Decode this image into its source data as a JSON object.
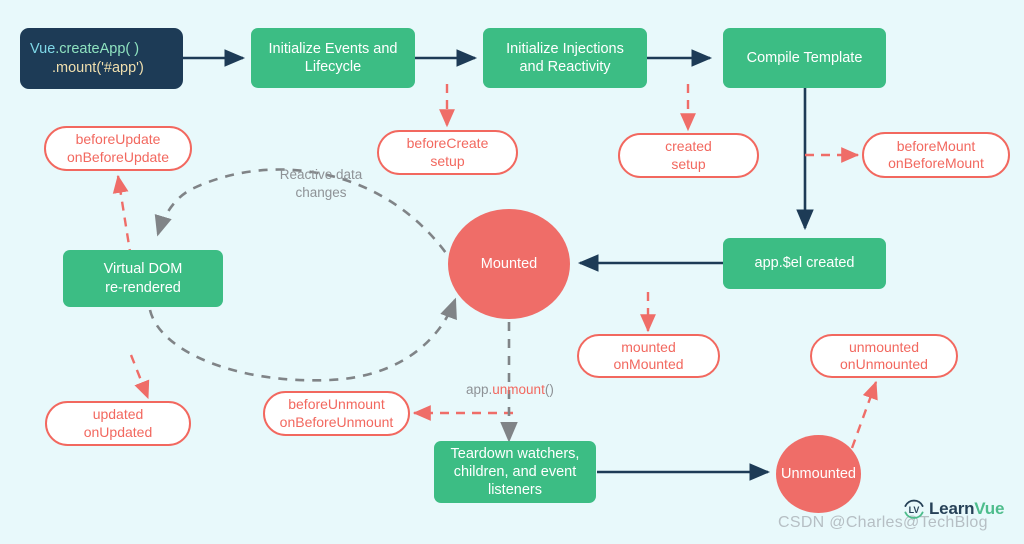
{
  "diagram": {
    "title": "Vue 3 Lifecycle Diagram",
    "background_color": "#e8f9fb",
    "colors": {
      "green": "#3cbd84",
      "dark_navy": "#1d3b56",
      "red": "#ef6d68",
      "pill_border": "#f2685f",
      "gray_dashed": "#808487",
      "label_gray": "#8e9296"
    }
  },
  "entry": {
    "line1_prefix": "Vue",
    "line1_rest": ".createApp( )",
    "line2": ".mount('#app')"
  },
  "stages": [
    {
      "label": "Initialize Events and Lifecycle"
    },
    {
      "label": "Initialize Injections and Reactivity"
    },
    {
      "label": "Compile Template"
    },
    {
      "label": "app.$el created"
    },
    {
      "label": "Virtual DOM re-rendered"
    },
    {
      "label": "Teardown watchers, children, and event listeners"
    }
  ],
  "stage_lines": {
    "init_events_1": "Initialize Events and",
    "init_events_2": "Lifecycle",
    "init_inject_1": "Initialize Injections",
    "init_inject_2": "and Reactivity",
    "compile_template": "Compile Template",
    "app_el_created": "app.$el created",
    "vdom_1": "Virtual DOM",
    "vdom_2": "re-rendered",
    "teardown_1": "Teardown watchers,",
    "teardown_2": "children, and event",
    "teardown_3": "listeners"
  },
  "hooks": [
    {
      "name": "beforeUpdate",
      "options_api": "beforeUpdate",
      "composition_api": "onBeforeUpdate"
    },
    {
      "name": "beforeCreate",
      "options_api": "beforeCreate",
      "composition_api": "setup"
    },
    {
      "name": "created",
      "options_api": "created",
      "composition_api": "setup"
    },
    {
      "name": "beforeMount",
      "options_api": "beforeMount",
      "composition_api": "onBeforeMount"
    },
    {
      "name": "mounted",
      "options_api": "mounted",
      "composition_api": "onMounted"
    },
    {
      "name": "unmounted",
      "options_api": "unmounted",
      "composition_api": "onUnmounted"
    },
    {
      "name": "updated",
      "options_api": "updated",
      "composition_api": "onUpdated"
    },
    {
      "name": "beforeUnmount",
      "options_api": "beforeUnmount",
      "composition_api": "onBeforeUnmount"
    }
  ],
  "states": {
    "mounted": "Mounted",
    "unmounted": "Unmounted"
  },
  "edge_labels": {
    "reactive_line1": "Reactive data",
    "reactive_line2": "changes",
    "unmount_prefix": "app.",
    "unmount_highlight": "unmount",
    "unmount_suffix": "()"
  },
  "watermark": {
    "text": "CSDN @Charles@TechBlog"
  },
  "logo": {
    "mark": "lv-circle-icon",
    "word_part1": "Learn",
    "word_part2": "Vue"
  }
}
